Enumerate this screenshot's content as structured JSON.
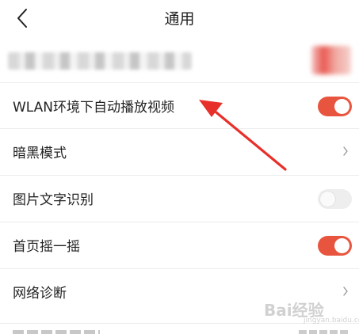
{
  "header": {
    "title": "通用"
  },
  "settings": {
    "items": [
      {
        "label": "WLAN环境下自动播放视频",
        "control": "toggle",
        "on": true
      },
      {
        "label": "暗黑模式",
        "control": "chevron"
      },
      {
        "label": "图片文字识别",
        "control": "toggle",
        "on": false
      },
      {
        "label": "首页摇一摇",
        "control": "toggle",
        "on": true
      },
      {
        "label": "网络诊断",
        "control": "chevron"
      }
    ]
  },
  "colors": {
    "toggle_on": "#e8553f",
    "toggle_off": "#eeeeee",
    "annotation_arrow": "#e8302a"
  },
  "watermark": {
    "text": "Bai经验",
    "sub": "jingyan.baidu.com"
  }
}
